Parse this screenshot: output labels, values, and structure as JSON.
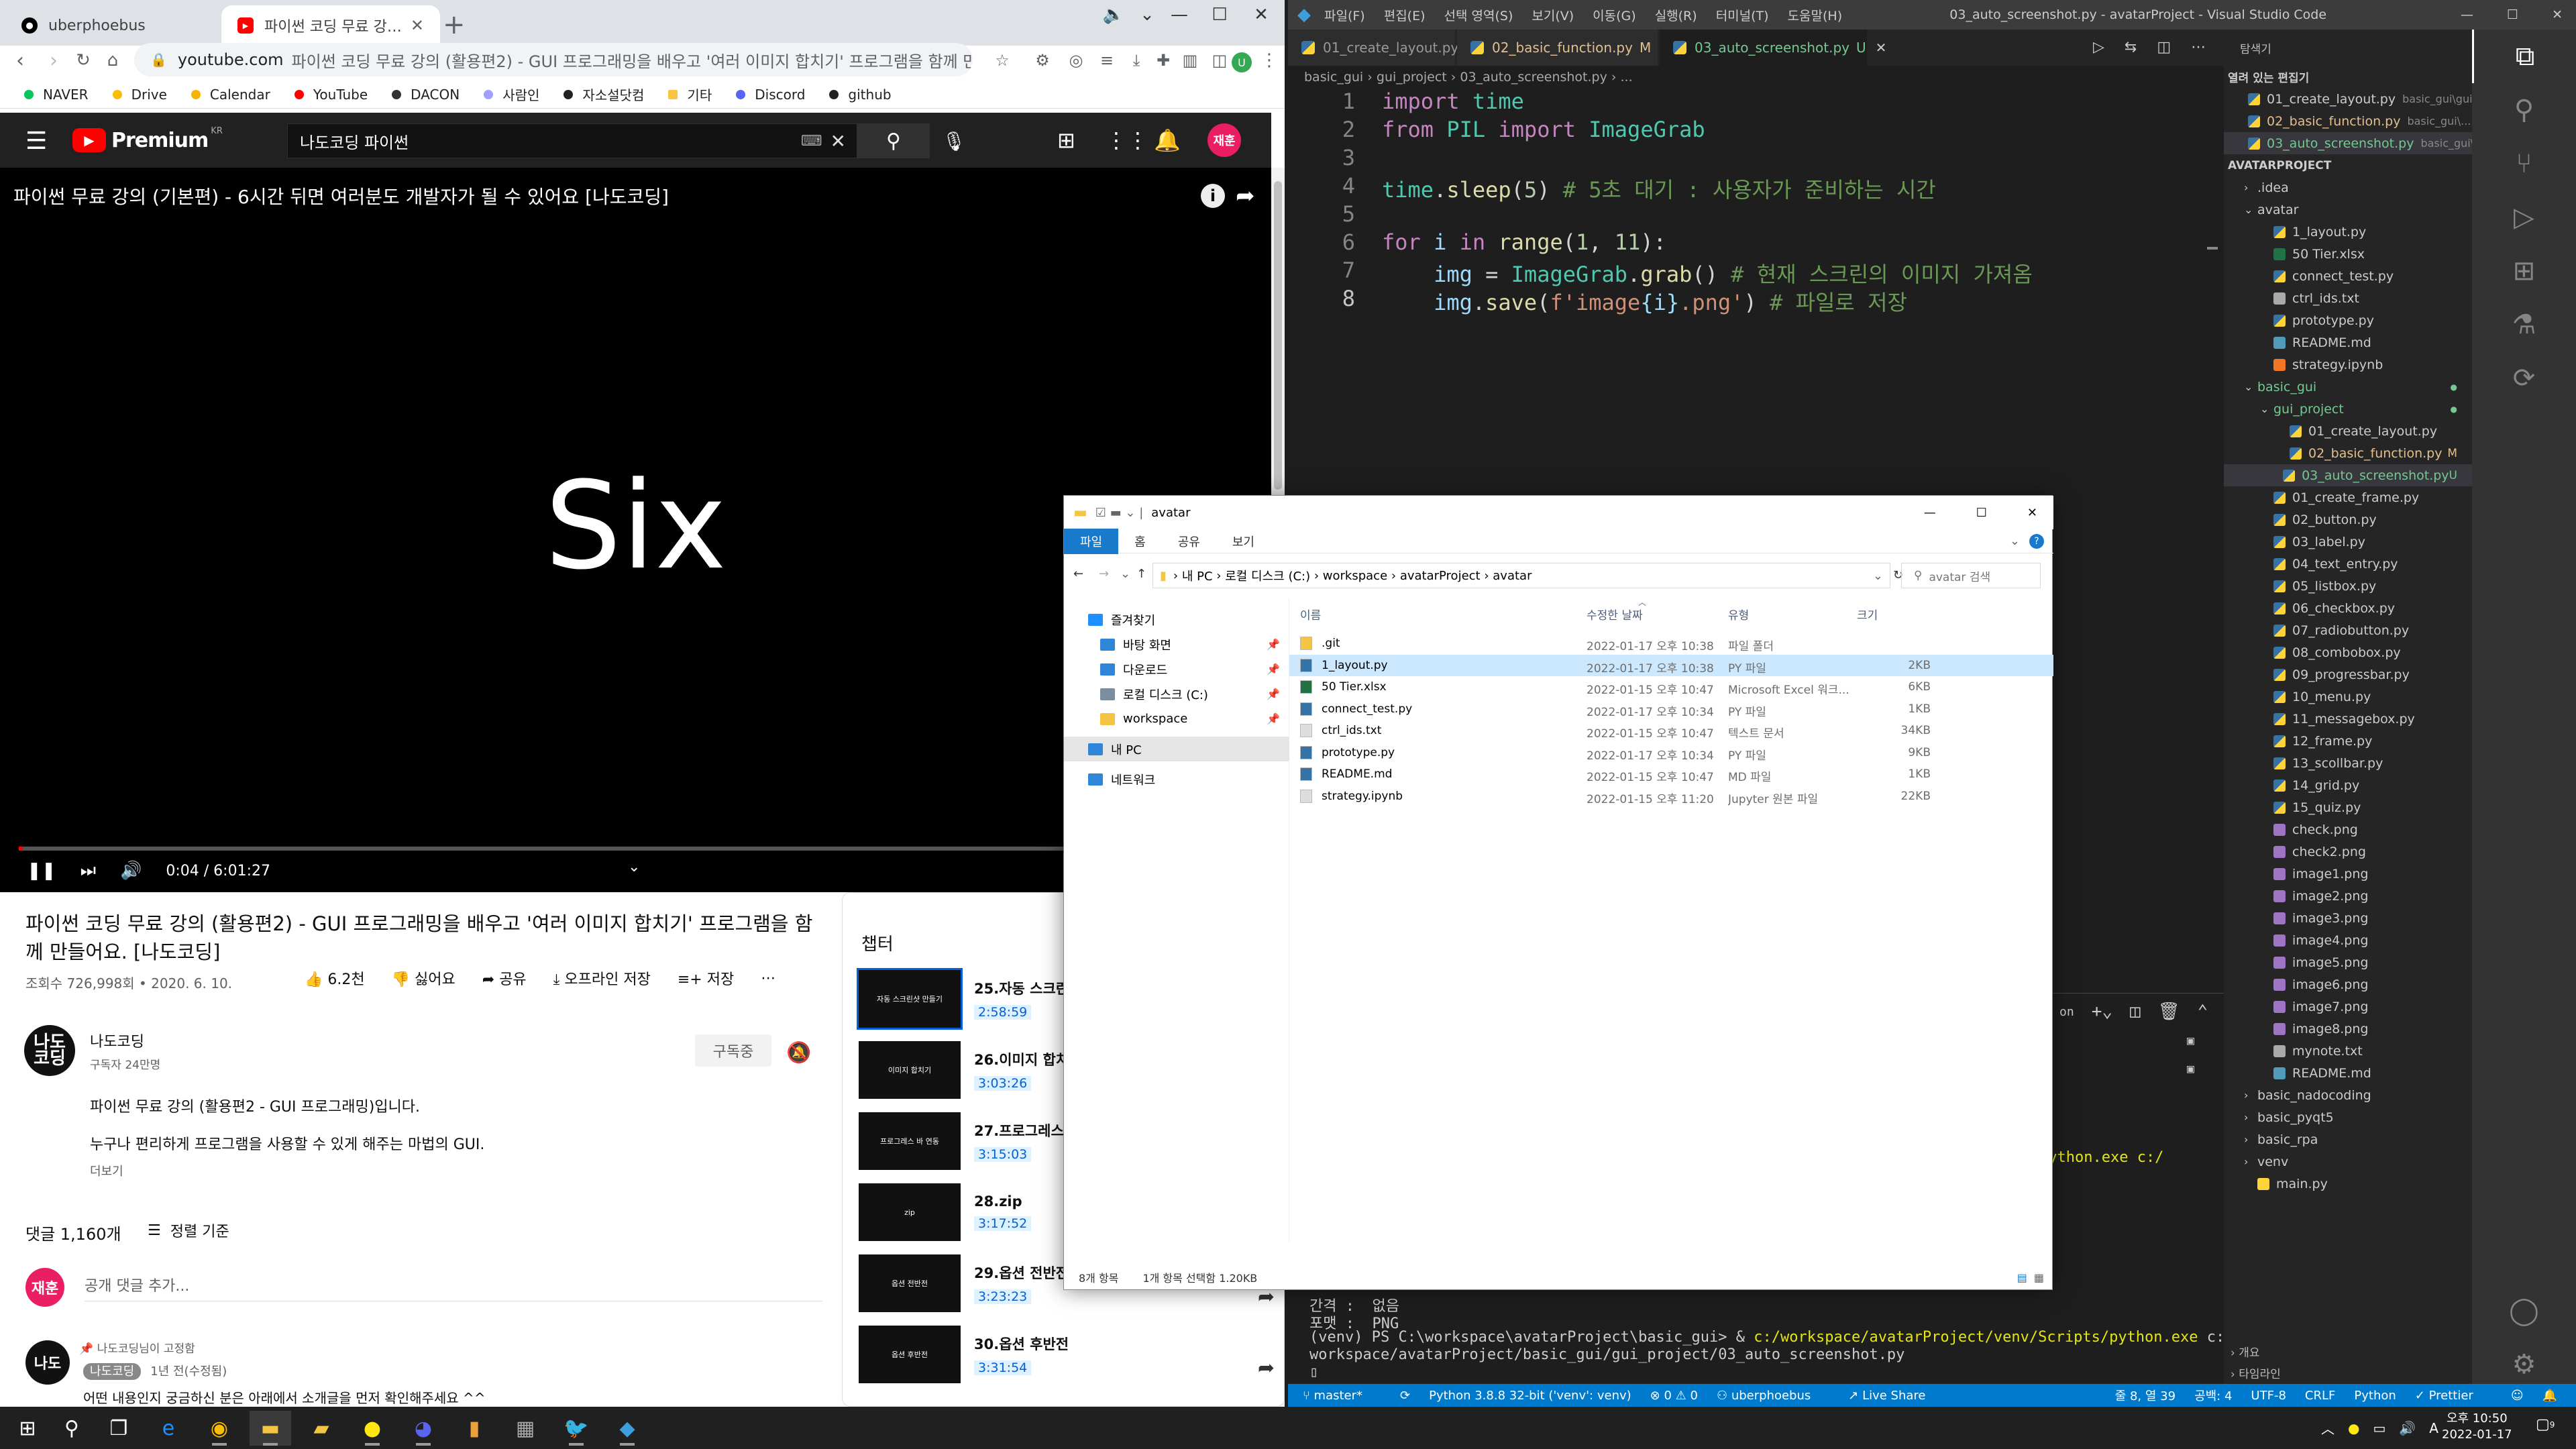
{
  "chrome": {
    "tabs": [
      {
        "title": "uberphoebus",
        "active": false
      },
      {
        "title": "파이썬 코딩 무료 강의 (활용편2) - GU",
        "active": true
      }
    ],
    "url_host": "youtube.com",
    "url_rest": "파이썬 코딩 무료 강의 (활용편2) - GUI 프로그래밍을 배우고 '여러 이미지 합치기' 프로그램을 함께 만들어요",
    "bookmarks": [
      {
        "label": "NAVER",
        "color": "#03c75a"
      },
      {
        "label": "Drive",
        "color": "#fbbc04"
      },
      {
        "label": "Calendar",
        "color": "#f4b400"
      },
      {
        "label": "YouTube",
        "color": "#ff0000"
      },
      {
        "label": "DACON",
        "color": "#333333"
      },
      {
        "label": "사람인",
        "color": "#a0a0ff"
      },
      {
        "label": "자소설닷컴",
        "color": "#222222"
      },
      {
        "label": "기타",
        "color": "#f9c642"
      },
      {
        "label": "Discord",
        "color": "#5865f2"
      },
      {
        "label": "github",
        "color": "#222222"
      }
    ]
  },
  "youtube": {
    "brand": "Premium",
    "region": "KR",
    "search_value": "나도코딩 파이썬",
    "avatar": "재훈",
    "player_title": "파이썬 무료 강의 (기본편) - 6시간 뒤면 여러분도 개발자가 될 수 있어요 [나도코딩]",
    "big_text": "Six",
    "time": "0:04 / 6:01:27",
    "progress": 0.0002,
    "video_title": "파이썬 코딩 무료 강의 (활용편2) - GUI 프로그래밍을 배우고 '여러 이미지 합치기' 프로그램을 함께 만들어요. [나도코딩]",
    "views": "조회수 726,998회 • 2020. 6. 10.",
    "actions": {
      "like": "6.2천",
      "dislike": "싫어요",
      "share": "공유",
      "offline": "오프라인 저장",
      "save": "저장"
    },
    "channel": {
      "name": "나도코딩",
      "subs": "구독자 24만명",
      "logo": "나도\n코딩",
      "subscribe": "구독중"
    },
    "desc1": "파이썬 무료 강의 (활용편2 - GUI 프로그래밍)입니다.",
    "desc2": "누구나 편리하게 프로그램을 사용할 수 있게 해주는 마법의 GUI.",
    "more": "더보기",
    "comment_count": "댓글 1,160개",
    "sort": "정렬 기준",
    "comment_placeholder": "공개 댓글 추가...",
    "pinned": "나도코딩님이 고정함",
    "comment_author": "나도코딩",
    "comment_ago": "1년 전(수정됨)",
    "comment_text": "어떤 내용인지 궁금하신 분은 아래에서 소개글을 먼저 확인해주세요 ^^",
    "chapters_title": "챕터",
    "chapters": [
      {
        "title": "25.자동 스크린",
        "time": "2:58:59",
        "thumb": "자동 스크린샷 만들기",
        "current": true
      },
      {
        "title": "26.이미지 합치",
        "time": "3:03:26",
        "thumb": "이미지 합치기",
        "current": false
      },
      {
        "title": "27.프로그레스",
        "time": "3:15:03",
        "thumb": "프로그레스 바 연동",
        "current": false
      },
      {
        "title": "28.zip",
        "time": "3:17:52",
        "thumb": "zip",
        "current": false
      },
      {
        "title": "29.옵션 전반전",
        "time": "3:23:23",
        "thumb": "옵션 전반전",
        "current": false
      },
      {
        "title": "30.옵션 후반전",
        "time": "3:31:54",
        "thumb": "옵션 후반전",
        "current": false
      }
    ]
  },
  "explorer": {
    "title": "avatar",
    "ribbon": [
      "파일",
      "홈",
      "공유",
      "보기"
    ],
    "path": [
      "내 PC",
      "로컬 디스크 (C:)",
      "workspace",
      "avatarProject",
      "avatar"
    ],
    "search_placeholder": "avatar 검색",
    "sidebar": [
      {
        "label": "즐겨찾기",
        "color": "#1e90ff",
        "pinned": false,
        "indent": 0
      },
      {
        "label": "바탕 화면",
        "color": "#2f86d8",
        "pinned": true,
        "indent": 1
      },
      {
        "label": "다운로드",
        "color": "#2f86d8",
        "pinned": true,
        "indent": 1
      },
      {
        "label": "로컬 디스크 (C:)",
        "color": "#7a8ea0",
        "pinned": true,
        "indent": 1
      },
      {
        "label": "workspace",
        "color": "#f4c542",
        "pinned": true,
        "indent": 1
      },
      {
        "label": "내 PC",
        "color": "#2f86d8",
        "pinned": false,
        "indent": 0,
        "selected": true
      },
      {
        "label": "네트워크",
        "color": "#2f86d8",
        "pinned": false,
        "indent": 0
      }
    ],
    "columns": [
      "이름",
      "수정한 날짜",
      "유형",
      "크기"
    ],
    "files": [
      {
        "name": ".git",
        "date": "2022-01-17 오후 10:38",
        "type": "파일 폴더",
        "size": "",
        "icon": "#f4c542"
      },
      {
        "name": "1_layout.py",
        "date": "2022-01-17 오후 10:38",
        "type": "PY 파일",
        "size": "2KB",
        "icon": "#3572a5",
        "selected": true
      },
      {
        "name": "50 Tier.xlsx",
        "date": "2022-01-15 오후 10:47",
        "type": "Microsoft Excel 워크...",
        "size": "6KB",
        "icon": "#217346"
      },
      {
        "name": "connect_test.py",
        "date": "2022-01-17 오후 10:34",
        "type": "PY 파일",
        "size": "1KB",
        "icon": "#3572a5"
      },
      {
        "name": "ctrl_ids.txt",
        "date": "2022-01-15 오후 10:47",
        "type": "텍스트 문서",
        "size": "34KB",
        "icon": "#dddddd"
      },
      {
        "name": "prototype.py",
        "date": "2022-01-17 오후 10:34",
        "type": "PY 파일",
        "size": "9KB",
        "icon": "#3572a5"
      },
      {
        "name": "README.md",
        "date": "2022-01-15 오후 10:47",
        "type": "MD 파일",
        "size": "1KB",
        "icon": "#3572a5"
      },
      {
        "name": "strategy.ipynb",
        "date": "2022-01-15 오후 11:20",
        "type": "Jupyter 원본 파일",
        "size": "22KB",
        "icon": "#dddddd"
      }
    ],
    "status_count": "8개 항목",
    "status_selected": "1개 항목 선택함 1.20KB"
  },
  "vscode": {
    "menu": [
      "파일(F)",
      "편집(E)",
      "선택 영역(S)",
      "보기(V)",
      "이동(G)",
      "실행(R)",
      "터미널(T)",
      "도움말(H)"
    ],
    "window_title": "03_auto_screenshot.py - avatarProject - Visual Studio Code",
    "tabs": [
      {
        "label": "01_create_layout.py",
        "mark": "",
        "active": false
      },
      {
        "label": "02_basic_function.py",
        "mark": "M",
        "active": false
      },
      {
        "label": "03_auto_screenshot.py",
        "mark": "U",
        "active": true
      }
    ],
    "breadcrumb": "basic_gui  ›  gui_project  ›  03_auto_screenshot.py  ›  ...",
    "code_lines": [
      "1",
      "2",
      "3",
      "4",
      "5",
      "6",
      "7",
      "8"
    ],
    "code": {
      "l1": [
        "import",
        " time"
      ],
      "l2": [
        "from",
        " PIL ",
        "import",
        " ImageGrab"
      ],
      "l4": [
        "time",
        ".",
        "sleep",
        "(",
        "5",
        ")",
        " # 5초 대기 : 사용자가 준비하는 시간"
      ],
      "l6": [
        "for",
        " i ",
        "in",
        " range",
        "(",
        "1",
        ", ",
        "11",
        "):"
      ],
      "l7": [
        "    ",
        "img",
        " = ",
        "ImageGrab",
        ".",
        "grab",
        "()",
        " # 현재 스크린의 이미지 가져옴"
      ],
      "l8": [
        "    ",
        "img",
        ".",
        "save",
        "(",
        "f'image",
        "{i}",
        ".png'",
        ")",
        " # 파일로 저장"
      ]
    },
    "terminal": {
      "partial1": "python.exe c:/",
      "gap_label": "간격 :  없음",
      "format_label": "포맷 :  PNG",
      "prompt": "(venv) PS C:\\workspace\\avatarProject\\basic_gui> & ",
      "cmd": "c:/workspace/avatarProject/venv/Scripts/python.exe",
      "cmd_rest": " c:/",
      "cont": "workspace/avatarProject/basic_gui/gui_project/03_auto_screenshot.py"
    },
    "explorer_title": "탐색기",
    "open_editors_title": "열려 있는 편집기",
    "open_editors": [
      {
        "label": "01_create_layout.py",
        "hint": "basic_gui\\gui_project",
        "badge": "",
        "color": "#ccc"
      },
      {
        "label": "02_basic_function.py",
        "hint": "basic_gui\\...",
        "badge": "M",
        "color": "#e2c08d"
      },
      {
        "label": "03_auto_screenshot.py",
        "hint": "basic_gui\\...",
        "badge": "U",
        "color": "#73c991",
        "selected": true
      }
    ],
    "project_title": "AVATARPROJECT",
    "tree": [
      {
        "label": ".idea",
        "type": "folder",
        "depth": 1,
        "open": false
      },
      {
        "label": "avatar",
        "type": "folder",
        "depth": 1,
        "open": true
      },
      {
        "label": "1_layout.py",
        "type": "py",
        "depth": 2
      },
      {
        "label": "50 Tier.xlsx",
        "type": "xls",
        "depth": 2
      },
      {
        "label": "connect_test.py",
        "type": "py",
        "depth": 2
      },
      {
        "label": "ctrl_ids.txt",
        "type": "txt",
        "depth": 2
      },
      {
        "label": "prototype.py",
        "type": "py",
        "depth": 2
      },
      {
        "label": "README.md",
        "type": "md",
        "depth": 2
      },
      {
        "label": "strategy.ipynb",
        "type": "nb",
        "depth": 2
      },
      {
        "label": "basic_gui",
        "type": "folder",
        "depth": 1,
        "open": true,
        "color": "#73c991",
        "dot": true
      },
      {
        "label": "gui_project",
        "type": "folder",
        "depth": 2,
        "open": true,
        "color": "#73c991",
        "dot": true
      },
      {
        "label": "01_create_layout.py",
        "type": "py",
        "depth": 3
      },
      {
        "label": "02_basic_function.py",
        "type": "py",
        "depth": 3,
        "color": "#e2c08d",
        "badge": "M"
      },
      {
        "label": "03_auto_screenshot.py",
        "type": "py",
        "depth": 3,
        "color": "#73c991",
        "badge": "U",
        "selected": true
      },
      {
        "label": "01_create_frame.py",
        "type": "py",
        "depth": 2
      },
      {
        "label": "02_button.py",
        "type": "py",
        "depth": 2
      },
      {
        "label": "03_label.py",
        "type": "py",
        "depth": 2
      },
      {
        "label": "04_text_entry.py",
        "type": "py",
        "depth": 2
      },
      {
        "label": "05_listbox.py",
        "type": "py",
        "depth": 2
      },
      {
        "label": "06_checkbox.py",
        "type": "py",
        "depth": 2
      },
      {
        "label": "07_radiobutton.py",
        "type": "py",
        "depth": 2
      },
      {
        "label": "08_combobox.py",
        "type": "py",
        "depth": 2
      },
      {
        "label": "09_progressbar.py",
        "type": "py",
        "depth": 2
      },
      {
        "label": "10_menu.py",
        "type": "py",
        "depth": 2
      },
      {
        "label": "11_messagebox.py",
        "type": "py",
        "depth": 2
      },
      {
        "label": "12_frame.py",
        "type": "py",
        "depth": 2
      },
      {
        "label": "13_scollbar.py",
        "type": "py",
        "depth": 2
      },
      {
        "label": "14_grid.py",
        "type": "py",
        "depth": 2
      },
      {
        "label": "15_quiz.py",
        "type": "py",
        "depth": 2
      },
      {
        "label": "check.png",
        "type": "png",
        "depth": 2
      },
      {
        "label": "check2.png",
        "type": "png",
        "depth": 2
      },
      {
        "label": "image1.png",
        "type": "png",
        "depth": 2
      },
      {
        "label": "image2.png",
        "type": "png",
        "depth": 2
      },
      {
        "label": "image3.png",
        "type": "png",
        "depth": 2
      },
      {
        "label": "image4.png",
        "type": "png",
        "depth": 2
      },
      {
        "label": "image5.png",
        "type": "png",
        "depth": 2
      },
      {
        "label": "image6.png",
        "type": "png",
        "depth": 2
      },
      {
        "label": "image7.png",
        "type": "png",
        "depth": 2
      },
      {
        "label": "image8.png",
        "type": "png",
        "depth": 2
      },
      {
        "label": "mynote.txt",
        "type": "txt",
        "depth": 2
      },
      {
        "label": "README.md",
        "type": "md",
        "depth": 2
      },
      {
        "label": "basic_nadocoding",
        "type": "folder",
        "depth": 1,
        "open": false
      },
      {
        "label": "basic_pyqt5",
        "type": "folder",
        "depth": 1,
        "open": false
      },
      {
        "label": "basic_rpa",
        "type": "folder",
        "depth": 1,
        "open": false
      },
      {
        "label": "venv",
        "type": "folder",
        "depth": 1,
        "open": false
      },
      {
        "label": "main.py",
        "type": "pyy",
        "depth": 1
      }
    ],
    "outline": "개요",
    "timeline": "타임라인",
    "status": {
      "branch": "master*",
      "python": "Python 3.8.8 32-bit ('venv': venv)",
      "problems": "⊗ 0 ⚠ 0",
      "user": "uberphoebus",
      "liveshare": "Live Share",
      "position": "줄 8, 열 39",
      "spaces": "공백: 4",
      "encoding": "UTF-8",
      "eol": "CRLF",
      "lang": "Python",
      "prettier": "Prettier"
    }
  },
  "taskbar": {
    "time": "오후 10:50",
    "date": "2022-01-17",
    "ime": "A",
    "notif": "9"
  }
}
